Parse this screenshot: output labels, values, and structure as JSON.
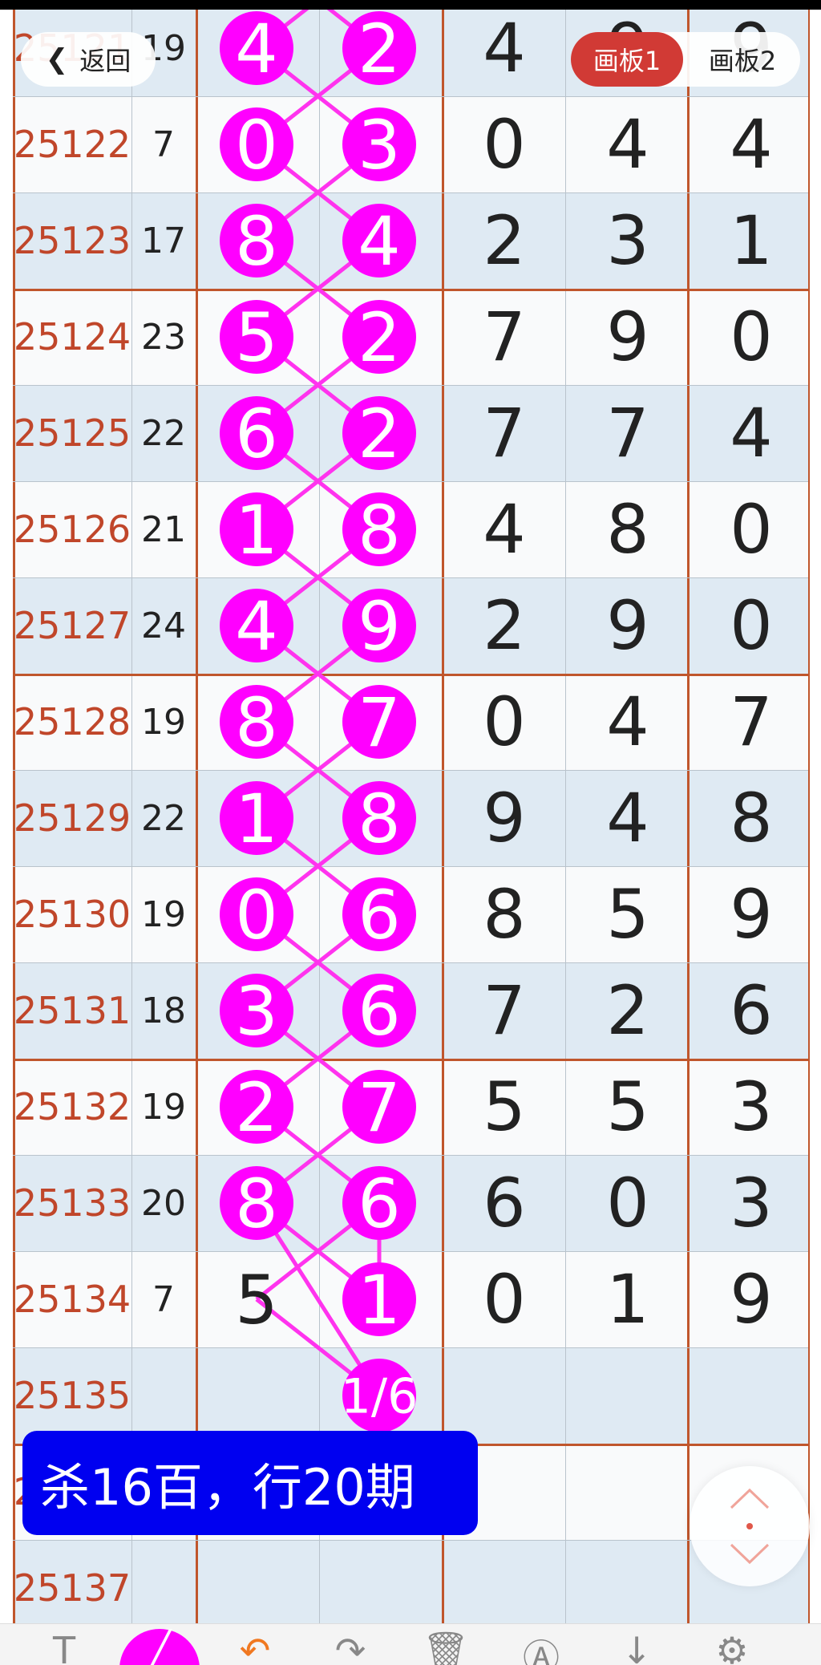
{
  "header": {
    "back_label": "返回",
    "tabs": [
      {
        "label": "画板1",
        "active": true
      },
      {
        "label": "画板2",
        "active": false
      }
    ]
  },
  "colors": {
    "period": "#c0462a",
    "ball": "#ff00ff",
    "line": "#ff33ee",
    "note_bg": "#0000f0",
    "tab_active": "#d13a35"
  },
  "rows": [
    {
      "period": "25121",
      "sum": "19",
      "a": "4",
      "b": "2",
      "d1": "4",
      "d2": "9",
      "d3": "9"
    },
    {
      "period": "25122",
      "sum": "7",
      "a": "0",
      "b": "3",
      "d1": "0",
      "d2": "4",
      "d3": "4"
    },
    {
      "period": "25123",
      "sum": "17",
      "a": "8",
      "b": "4",
      "d1": "2",
      "d2": "3",
      "d3": "1"
    },
    {
      "period": "25124",
      "sum": "23",
      "a": "5",
      "b": "2",
      "d1": "7",
      "d2": "9",
      "d3": "0"
    },
    {
      "period": "25125",
      "sum": "22",
      "a": "6",
      "b": "2",
      "d1": "7",
      "d2": "7",
      "d3": "4"
    },
    {
      "period": "25126",
      "sum": "21",
      "a": "1",
      "b": "8",
      "d1": "4",
      "d2": "8",
      "d3": "0"
    },
    {
      "period": "25127",
      "sum": "24",
      "a": "4",
      "b": "9",
      "d1": "2",
      "d2": "9",
      "d3": "0"
    },
    {
      "period": "25128",
      "sum": "19",
      "a": "8",
      "b": "7",
      "d1": "0",
      "d2": "4",
      "d3": "7"
    },
    {
      "period": "25129",
      "sum": "22",
      "a": "1",
      "b": "8",
      "d1": "9",
      "d2": "4",
      "d3": "8"
    },
    {
      "period": "25130",
      "sum": "19",
      "a": "0",
      "b": "6",
      "d1": "8",
      "d2": "5",
      "d3": "9"
    },
    {
      "period": "25131",
      "sum": "18",
      "a": "3",
      "b": "6",
      "d1": "7",
      "d2": "2",
      "d3": "6"
    },
    {
      "period": "25132",
      "sum": "19",
      "a": "2",
      "b": "7",
      "d1": "5",
      "d2": "5",
      "d3": "3"
    },
    {
      "period": "25133",
      "sum": "20",
      "a": "8",
      "b": "6",
      "d1": "6",
      "d2": "0",
      "d3": "3"
    },
    {
      "period": "25134",
      "sum": "7",
      "a": "5",
      "b": "1",
      "d1": "0",
      "d2": "1",
      "d3": "9"
    },
    {
      "period": "25135",
      "sum": "",
      "a": "",
      "b": "1/6",
      "d1": "",
      "d2": "",
      "d3": ""
    },
    {
      "period": "25136",
      "sum": "",
      "a": "",
      "b": "",
      "d1": "",
      "d2": "",
      "d3": ""
    },
    {
      "period": "25137",
      "sum": "",
      "a": "",
      "b": "",
      "d1": "",
      "d2": "",
      "d3": ""
    }
  ],
  "note": {
    "text": "杀16百，行20期"
  },
  "toolbar": {
    "tools": [
      {
        "icon": "text-tool-icon",
        "glyph": "T"
      },
      {
        "icon": "pen-tool-icon",
        "glyph": "╱"
      },
      {
        "icon": "undo-icon",
        "glyph": "↶"
      },
      {
        "icon": "redo-icon",
        "glyph": "↷"
      },
      {
        "icon": "delete-icon",
        "glyph": "🗑"
      },
      {
        "icon": "auto-icon",
        "glyph": "Ⓐ"
      },
      {
        "icon": "download-icon",
        "glyph": "↓"
      },
      {
        "icon": "settings-icon",
        "glyph": "⚙"
      }
    ]
  }
}
